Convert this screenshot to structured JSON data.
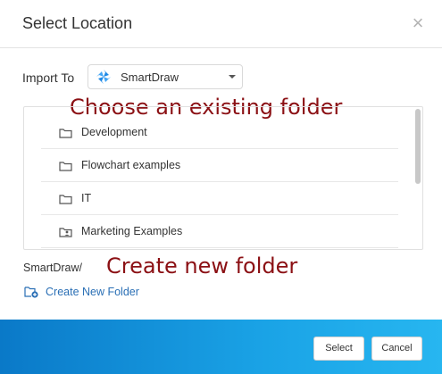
{
  "dialog": {
    "title": "Select Location",
    "close_symbol": "×"
  },
  "import": {
    "label": "Import To",
    "selected": "SmartDraw",
    "logo_icon": "smartdraw-logo-icon"
  },
  "annotations": {
    "choose_folder": "Choose an existing folder",
    "create_folder": "Create new folder"
  },
  "folders": [
    {
      "label": "Development",
      "icon": "folder-icon"
    },
    {
      "label": "Flowchart examples",
      "icon": "folder-icon"
    },
    {
      "label": "IT",
      "icon": "folder-icon"
    },
    {
      "label": "Marketing Examples",
      "icon": "shared-folder-icon"
    }
  ],
  "path": "SmartDraw/",
  "create_new_folder": {
    "label": "Create New Folder",
    "icon": "new-folder-icon"
  },
  "footer": {
    "select_label": "Select",
    "cancel_label": "Cancel"
  },
  "colors": {
    "annotation": "#8b1014",
    "link": "#2a6fb5",
    "footer_gradient_start": "#0a79c8",
    "footer_gradient_end": "#27b6f0"
  }
}
